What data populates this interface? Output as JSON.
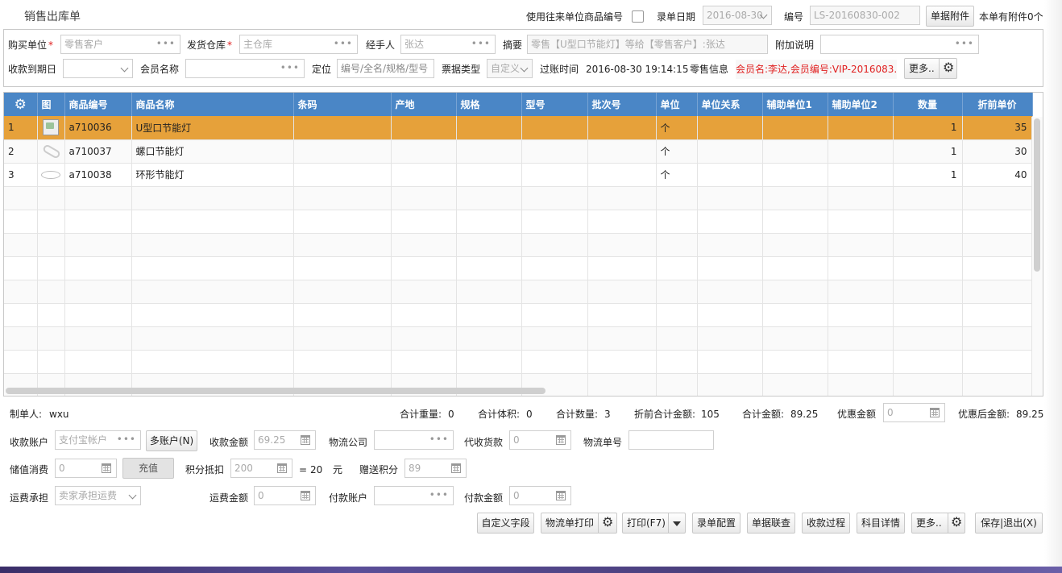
{
  "title": "销售出库单",
  "top": {
    "use_unit_code_label": "使用往来单位商品编号",
    "date_label": "录单日期",
    "date_value": "2016-08-30",
    "no_label": "编号",
    "no_value": "LS-20160830-002",
    "attach_button": "单据附件",
    "attach_info": "本单有附件0个"
  },
  "header": {
    "buyer_label": "购买单位",
    "buyer_value": "零售客户",
    "warehouse_label": "发货仓库",
    "warehouse_value": "主仓库",
    "handler_label": "经手人",
    "handler_value": "张达",
    "summary_label": "摘要",
    "summary_value": "零售【U型口节能灯】等给【零售客户】:张达",
    "note_label": "附加说明",
    "note_value": "",
    "due_label": "收款到期日",
    "due_value": "",
    "member_label": "会员名称",
    "member_value": "",
    "locate_label": "定位",
    "locate_placeholder": "编号/全名/规格/型号",
    "ticket_label": "票据类型",
    "ticket_value": "自定义",
    "post_time_label": "过账时间",
    "post_time_value": "2016-08-30 19:14:15",
    "retail_label": "零售信息",
    "retail_value": "会员名:李达,会员编号:VIP-2016083...",
    "more_button": "更多..",
    "required_mark": "*"
  },
  "grid": {
    "columns": [
      "图",
      "商品编号",
      "商品名称",
      "条码",
      "产地",
      "规格",
      "型号",
      "批次号",
      "单位",
      "单位关系",
      "辅助单位1",
      "辅助单位2",
      "数量",
      "折前单价"
    ],
    "rows": [
      {
        "n": "1",
        "code": "a710036",
        "name": "U型口节能灯",
        "unit": "个",
        "qty": "1",
        "price": "35"
      },
      {
        "n": "2",
        "code": "a710037",
        "name": "螺口节能灯",
        "unit": "个",
        "qty": "1",
        "price": "30"
      },
      {
        "n": "3",
        "code": "a710038",
        "name": "环形节能灯",
        "unit": "个",
        "qty": "1",
        "price": "40"
      }
    ]
  },
  "summary": {
    "maker_label": "制单人:",
    "maker_value": "wxu",
    "weight_label": "合计重量:",
    "weight_value": "0",
    "volume_label": "合计体积:",
    "volume_value": "0",
    "qty_label": "合计数量:",
    "qty_value": "3",
    "pre_amount_label": "折前合计金额:",
    "pre_amount_value": "105",
    "amount_label": "合计金额:",
    "amount_value": "89.25",
    "discount_label": "优惠金额",
    "discount_value": "0",
    "after_label": "优惠后金额:",
    "after_value": "89.25"
  },
  "payment": {
    "account_label": "收款账户",
    "account_value": "支付宝帐户",
    "multi_button": "多账户(N)",
    "receive_label": "收款金额",
    "receive_value": "69.25",
    "logistics_label": "物流公司",
    "logistics_value": "",
    "cod_label": "代收货款",
    "cod_value": "0",
    "track_label": "物流单号",
    "track_value": "",
    "stored_label": "储值消费",
    "stored_value": "0",
    "recharge_button": "充值",
    "points_label": "积分抵扣",
    "points_value": "200",
    "equals": "=",
    "points_money": "20",
    "yuan": "元",
    "gift_points_label": "赠送积分",
    "gift_points_value": "89",
    "freight_label": "运费承担",
    "freight_value": "卖家承担运费",
    "freight_amount_label": "运费金额",
    "freight_amount_value": "0",
    "pay_account_label": "付款账户",
    "pay_account_value": "",
    "pay_amount_label": "付款金额",
    "pay_amount_value": "0"
  },
  "footer": {
    "custom_fields": "自定义字段",
    "logistics_print": "物流单打印",
    "print": "打印(F7)",
    "config": "录单配置",
    "linked": "单据联查",
    "process": "收款过程",
    "subject": "科目详情",
    "more": "更多..",
    "save_exit": "保存|退出(X)"
  }
}
